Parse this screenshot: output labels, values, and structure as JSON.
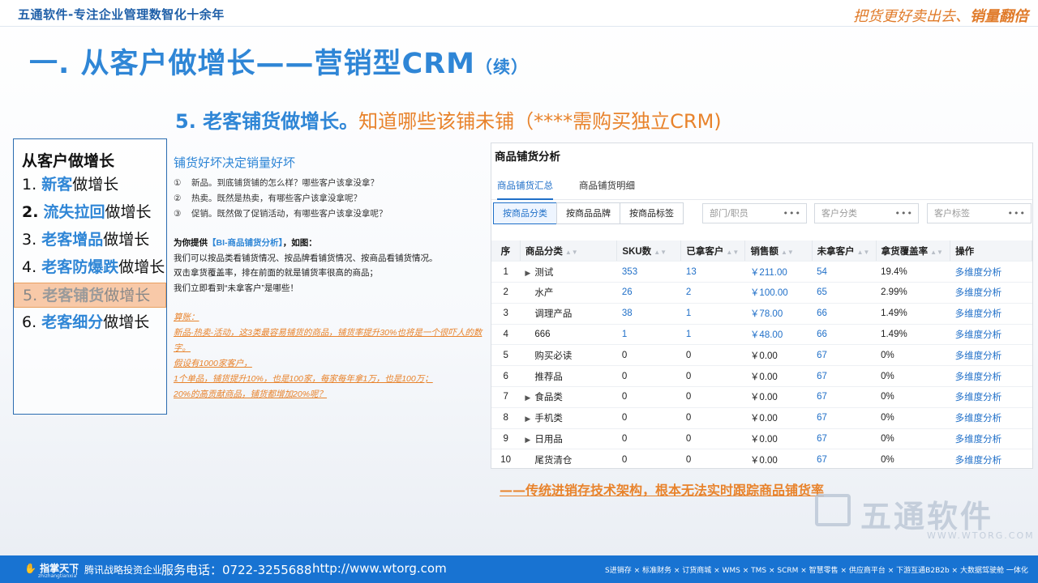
{
  "header": {
    "brand": "五通软件-专注企业管理数智化十余年",
    "slogan_a": "把货更好卖出去、",
    "slogan_b": "销量翻倍"
  },
  "title": {
    "main": "一. 从客户做增长——营销型CRM",
    "suffix": "（续）"
  },
  "subtitle": {
    "a": "5. 老客铺货做增长。",
    "b": "知道哪些该铺未铺（****需购买独立CRM)"
  },
  "outline": {
    "heading": "从客户做增长",
    "items": [
      {
        "num": "1.",
        "hl": "新客",
        "tail": "做增长"
      },
      {
        "num": "2.",
        "hl": "流失拉回",
        "tail": "做增长"
      },
      {
        "num": "3.",
        "hl": "老客增品",
        "tail": "做增长"
      },
      {
        "num": "4.",
        "hl": "老客防爆跌",
        "tail": "做增长"
      },
      {
        "num": "5.",
        "hl": "老客铺货",
        "tail": "做增长"
      },
      {
        "num": "6.",
        "hl": "老客细分",
        "tail": "做增长"
      }
    ]
  },
  "middle": {
    "heading": "铺货好坏决定销量好坏",
    "questions": [
      {
        "n": "①",
        "text": "新品。到底铺货铺的怎么样？哪些客户该拿没拿？"
      },
      {
        "n": "②",
        "text": "热卖。既然是热卖，有哪些客户该拿没拿呢？"
      },
      {
        "n": "③",
        "text": "促销。既然做了促销活动，有哪些客户该拿没拿呢？"
      }
    ],
    "provide_a": "为你提供",
    "provide_bi": "【BI-商品铺货分析】",
    "provide_b": "，如图：",
    "lines": [
      "我们可以按品类看铺货情况、按品牌看铺货情况、按商品看铺货情况。",
      "双击拿货覆盖率，排在前面的就是铺货率很高的商品；",
      "我们立即看到“未拿客户”是哪些！"
    ],
    "calc": [
      "算账：",
      "新品-热卖-活动，这3类最容易铺货的商品，铺货率提升30%也将是一个很吓人的数字。",
      "假设有1000家客户，",
      "1个单品，铺货提升10%，也是100家，每家每年拿1万，也是100万；",
      "20%的高贡献商品，铺货都增加20%呢？"
    ]
  },
  "panel": {
    "title": "商品铺货分析",
    "tabs": [
      "商品铺货汇总",
      "商品铺货明细"
    ],
    "buttons": [
      "按商品分类",
      "按商品品牌",
      "按商品标签"
    ],
    "filters": [
      "部门/职员",
      "客户分类",
      "客户标签"
    ],
    "columns": [
      "序",
      "商品分类",
      "SKU数",
      "已拿客户",
      "销售额",
      "未拿客户",
      "拿货覆盖率",
      "操作"
    ],
    "rows": [
      {
        "no": "1",
        "name": "测试",
        "caret": true,
        "sku": "353",
        "got": "13",
        "sales": "￥211.00",
        "miss": "54",
        "rate": "19.4%",
        "op": "多维度分析"
      },
      {
        "no": "2",
        "name": "水产",
        "caret": false,
        "sku": "26",
        "got": "2",
        "sales": "￥100.00",
        "miss": "65",
        "rate": "2.99%",
        "op": "多维度分析"
      },
      {
        "no": "3",
        "name": "调理产品",
        "caret": false,
        "sku": "38",
        "got": "1",
        "sales": "￥78.00",
        "miss": "66",
        "rate": "1.49%",
        "op": "多维度分析"
      },
      {
        "no": "4",
        "name": "666",
        "caret": false,
        "sku": "1",
        "got": "1",
        "sales": "￥48.00",
        "miss": "66",
        "rate": "1.49%",
        "op": "多维度分析"
      },
      {
        "no": "5",
        "name": "购买必读",
        "caret": false,
        "sku": "0",
        "got": "0",
        "sales": "￥0.00",
        "miss": "67",
        "rate": "0%",
        "op": "多维度分析"
      },
      {
        "no": "6",
        "name": "推荐品",
        "caret": false,
        "sku": "0",
        "got": "0",
        "sales": "￥0.00",
        "miss": "67",
        "rate": "0%",
        "op": "多维度分析"
      },
      {
        "no": "7",
        "name": "食品类",
        "caret": true,
        "sku": "0",
        "got": "0",
        "sales": "￥0.00",
        "miss": "67",
        "rate": "0%",
        "op": "多维度分析"
      },
      {
        "no": "8",
        "name": "手机类",
        "caret": true,
        "sku": "0",
        "got": "0",
        "sales": "￥0.00",
        "miss": "67",
        "rate": "0%",
        "op": "多维度分析"
      },
      {
        "no": "9",
        "name": "日用品",
        "caret": true,
        "sku": "0",
        "got": "0",
        "sales": "￥0.00",
        "miss": "67",
        "rate": "0%",
        "op": "多维度分析"
      },
      {
        "no": "10",
        "name": "尾货清仓",
        "caret": false,
        "sku": "0",
        "got": "0",
        "sales": "￥0.00",
        "miss": "67",
        "rate": "0%",
        "op": "多维度分析"
      }
    ]
  },
  "conclusion": "——传统进销存技术架构，根本无法实时跟踪商品铺货率",
  "watermark": {
    "text": "五通软件",
    "url": "WWW.WTORG.COM"
  },
  "footer": {
    "logo": "指掌天下",
    "logo_sub": "zhizhangtianxia",
    "invest": "腾讯战略投资企业",
    "phone": "服务电话：0722-3255688",
    "url": "http://www.wtorg.com",
    "products": "S进销存 × 标准财务 × 订货商城 × WMS × TMS × SCRM × 智慧零售 × 供应商平台 × 下游互通B2B2b × 大数据驾驶舱 一体化"
  },
  "colors": {
    "brand_blue": "#2f86d6",
    "accent_orange": "#e8832c",
    "footer_blue": "#1873d2"
  }
}
